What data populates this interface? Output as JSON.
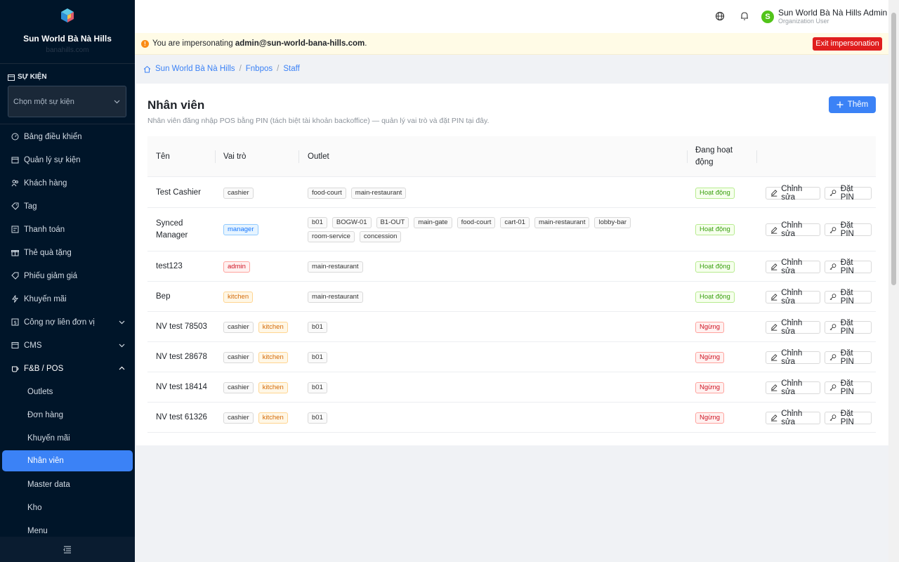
{
  "sidebar": {
    "brand_name": "Sun World Bà Nà Hills",
    "brand_sub": "banahills.com",
    "event_section_label": "SỰ KIỆN",
    "event_placeholder": "Chọn một sự kiện",
    "items": [
      {
        "label": "Bảng điều khiển",
        "icon": "dashboard-icon"
      },
      {
        "label": "Quản lý sự kiện",
        "icon": "calendar-icon"
      },
      {
        "label": "Khách hàng",
        "icon": "users-icon"
      },
      {
        "label": "Tag",
        "icon": "tag-icon"
      },
      {
        "label": "Thanh toán",
        "icon": "payment-icon"
      },
      {
        "label": "Thẻ quà tặng",
        "icon": "gift-icon"
      },
      {
        "label": "Phiếu giảm giá",
        "icon": "coupon-icon"
      },
      {
        "label": "Khuyến mãi",
        "icon": "promotion-icon"
      },
      {
        "label": "Công nợ liên đơn vị",
        "icon": "debt-icon"
      },
      {
        "label": "CMS",
        "icon": "cms-icon"
      },
      {
        "label": "F&B / POS",
        "icon": "coffee-icon"
      }
    ],
    "subitems": [
      {
        "label": "Outlets"
      },
      {
        "label": "Đơn hàng"
      },
      {
        "label": "Khuyến mãi"
      },
      {
        "label": "Nhân viên"
      },
      {
        "label": "Master data"
      },
      {
        "label": "Kho"
      },
      {
        "label": "Menu"
      }
    ]
  },
  "topbar": {
    "user_name": "Sun World Bà Nà Hills Admin",
    "user_role": "Organization User",
    "avatar_letter": "S"
  },
  "impersonation": {
    "prefix": "You are impersonating ",
    "email": "admin@sun-world-bana-hills.com",
    "suffix": ".",
    "exit_label": "Exit impersonation"
  },
  "breadcrumb": [
    "Sun World Bà Nà Hills",
    "Fnbpos",
    "Staff"
  ],
  "page": {
    "title": "Nhân viên",
    "description": "Nhân viên đăng nhập POS bằng PIN (tách biệt tài khoản backoffice) — quản lý vai trò và đặt PIN tại đây.",
    "add_label": "Thêm"
  },
  "table": {
    "columns": {
      "name": "Tên",
      "role": "Vai trò",
      "outlet": "Outlet",
      "active_1": "Đang hoạt",
      "active_2": "động"
    },
    "edit_label": "Chỉnh sửa",
    "pin_label": "Đặt PIN",
    "rows": [
      {
        "name_1": "Test Cashier",
        "name_2": "",
        "roles": [
          {
            "label": "cashier",
            "color": "#333333"
          }
        ],
        "outlets": [
          "food-court",
          "main-restaurant"
        ],
        "status": "Hoạt động",
        "status_color": "#389e0d"
      },
      {
        "name_1": "Synced",
        "name_2": "Manager",
        "roles": [
          {
            "label": "manager",
            "color": "#1677ff"
          }
        ],
        "outlets": [
          "b01",
          "BOGW-01",
          "B1-OUT",
          "main-gate",
          "food-court",
          "cart-01",
          "main-restaurant",
          "lobby-bar",
          "room-service",
          "concession"
        ],
        "status": "Hoạt động",
        "status_color": "#389e0d"
      },
      {
        "name_1": "test123",
        "name_2": "",
        "roles": [
          {
            "label": "admin",
            "color": "#cf1322"
          }
        ],
        "outlets": [
          "main-restaurant"
        ],
        "status": "Hoạt động",
        "status_color": "#389e0d"
      },
      {
        "name_1": "Bep",
        "name_2": "",
        "roles": [
          {
            "label": "kitchen",
            "color": "#d46b08"
          }
        ],
        "outlets": [
          "main-restaurant"
        ],
        "status": "Hoạt động",
        "status_color": "#389e0d"
      },
      {
        "name_1": "NV test 78503",
        "name_2": "",
        "roles": [
          {
            "label": "cashier",
            "color": "#333333"
          },
          {
            "label": "kitchen",
            "color": "#d46b08"
          }
        ],
        "outlets": [
          "b01"
        ],
        "status": "Ngừng",
        "status_color": "#cf1322"
      },
      {
        "name_1": "NV test 28678",
        "name_2": "",
        "roles": [
          {
            "label": "cashier",
            "color": "#333333"
          },
          {
            "label": "kitchen",
            "color": "#d46b08"
          }
        ],
        "outlets": [
          "b01"
        ],
        "status": "Ngừng",
        "status_color": "#cf1322"
      },
      {
        "name_1": "NV test 18414",
        "name_2": "",
        "roles": [
          {
            "label": "cashier",
            "color": "#333333"
          },
          {
            "label": "kitchen",
            "color": "#d46b08"
          }
        ],
        "outlets": [
          "b01"
        ],
        "status": "Ngừng",
        "status_color": "#cf1322"
      },
      {
        "name_1": "NV test 61326",
        "name_2": "",
        "roles": [
          {
            "label": "cashier",
            "color": "#333333"
          },
          {
            "label": "kitchen",
            "color": "#d46b08"
          }
        ],
        "outlets": [
          "b01"
        ],
        "status": "Ngừng",
        "status_color": "#cf1322"
      }
    ]
  },
  "colors": {
    "sidebar_bg": "#001529",
    "accent": "#3b82f6",
    "danger": "#e01e1e"
  }
}
